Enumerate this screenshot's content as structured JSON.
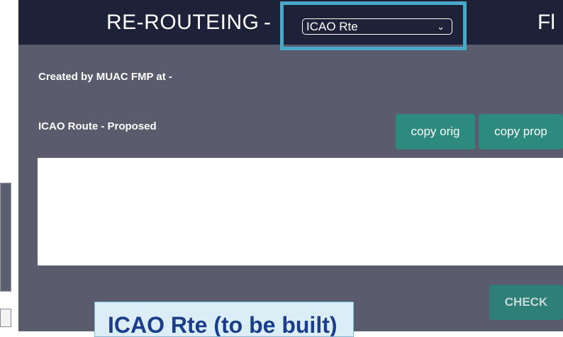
{
  "header": {
    "title": "RE-ROUTEING",
    "separator": "-",
    "title_right": "Fl",
    "route_select": {
      "value": "ICAO Rte",
      "chevron": "⌄"
    }
  },
  "form": {
    "created_by": "Created by MUAC FMP at -",
    "route_label": "ICAO Route - Proposed",
    "copy_orig_label": "copy orig",
    "copy_prop_label": "copy prop",
    "route_text": "",
    "check_label": "CHECK"
  },
  "callout": {
    "text": "ICAO Rte (to be built)"
  },
  "colors": {
    "header_bg": "#1e2238",
    "panel_bg": "#5a5c6e",
    "button": "#2c8b7e",
    "highlight": "#4aa8c8",
    "callout_text": "#1a3e8c"
  }
}
